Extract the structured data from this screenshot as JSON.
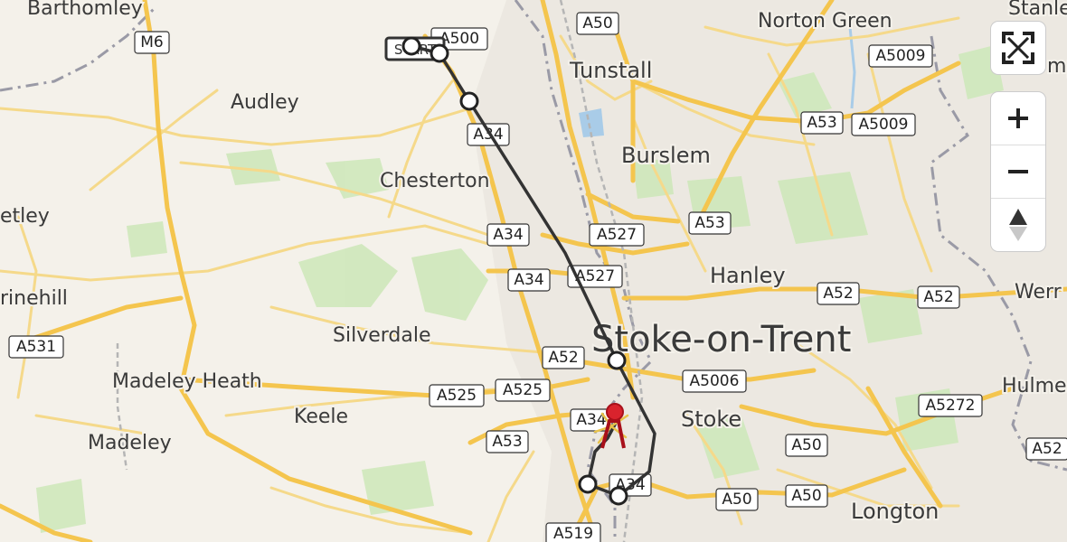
{
  "map": {
    "places": [
      {
        "key": "barthomley",
        "text": "Barthomley"
      },
      {
        "key": "norton_green",
        "text": "Norton Green"
      },
      {
        "key": "stanley",
        "text": "Stanley"
      },
      {
        "key": "tunstall",
        "text": "Tunstall"
      },
      {
        "key": "audley",
        "text": "Audley"
      },
      {
        "key": "burslem",
        "text": "Burslem"
      },
      {
        "key": "chesterton",
        "text": "Chesterton"
      },
      {
        "key": "etley",
        "text": "etley"
      },
      {
        "key": "hanley",
        "text": "Hanley"
      },
      {
        "key": "werr",
        "text": "Werr"
      },
      {
        "key": "rinehill",
        "text": "rinehill"
      },
      {
        "key": "silverdale",
        "text": "Silverdale"
      },
      {
        "key": "stoke_on_trent",
        "text": "Stoke-on-Trent"
      },
      {
        "key": "madeley_heath",
        "text": "Madeley Heath"
      },
      {
        "key": "keele",
        "text": "Keele"
      },
      {
        "key": "stoke",
        "text": "Stoke"
      },
      {
        "key": "madeley",
        "text": "Madeley"
      },
      {
        "key": "longton",
        "text": "Longton"
      },
      {
        "key": "hulme",
        "text": "Hulme"
      },
      {
        "key": "mp",
        "text": "mp"
      }
    ],
    "shields": [
      {
        "key": "m6",
        "text": "M6"
      },
      {
        "key": "a50_n",
        "text": "A50"
      },
      {
        "key": "a500",
        "text": "A500"
      },
      {
        "key": "a5009_a",
        "text": "A5009"
      },
      {
        "key": "a53_ne",
        "text": "A53"
      },
      {
        "key": "a5009_b",
        "text": "A5009"
      },
      {
        "key": "a34_n",
        "text": "A34"
      },
      {
        "key": "a34_mid",
        "text": "A34"
      },
      {
        "key": "a527_a",
        "text": "A527"
      },
      {
        "key": "a53_mid",
        "text": "A53"
      },
      {
        "key": "a34_b",
        "text": "A34"
      },
      {
        "key": "a527_b",
        "text": "A527"
      },
      {
        "key": "a52_e",
        "text": "A52"
      },
      {
        "key": "a52_far",
        "text": "A52"
      },
      {
        "key": "a531",
        "text": "A531"
      },
      {
        "key": "a52_c",
        "text": "A52"
      },
      {
        "key": "a5006",
        "text": "A5006"
      },
      {
        "key": "a525_a",
        "text": "A525"
      },
      {
        "key": "a525_b",
        "text": "A525"
      },
      {
        "key": "a5272",
        "text": "A5272"
      },
      {
        "key": "a34_s",
        "text": "A34"
      },
      {
        "key": "a53_s",
        "text": "A53"
      },
      {
        "key": "a50_s",
        "text": "A50"
      },
      {
        "key": "a52_se",
        "text": "A52"
      },
      {
        "key": "a34_ss",
        "text": "A34"
      },
      {
        "key": "a50_sw",
        "text": "A50"
      },
      {
        "key": "a50_se2",
        "text": "A50"
      },
      {
        "key": "a519",
        "text": "A519"
      }
    ],
    "route": {
      "start_label": "START",
      "color": "#333333"
    }
  },
  "controls": {
    "fullscreen_icon": "fullscreen-icon",
    "zoom_in_icon": "plus-icon",
    "zoom_out_icon": "minus-icon",
    "compass_icon": "compass-icon"
  }
}
